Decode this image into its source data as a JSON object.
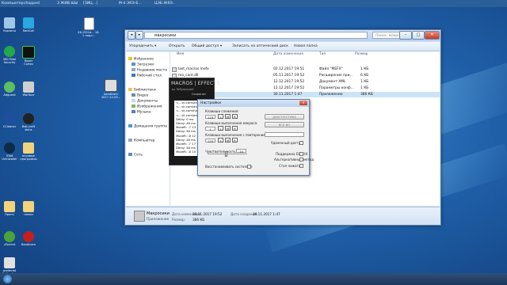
{
  "colors": {
    "desktop": "#1f5fa8",
    "window_frame": "#cfe0f3",
    "macros_bg": "#1a1a1a",
    "close_red": "#c33d26"
  },
  "topstrip": {
    "items": [
      "Компьютер",
      "chopped",
      "3 ЖИВ.ШЫ",
      "[ЗИЦ...]",
      "M-4 ЭКЭ-Б... ",
      "ЦЭБ.ЖЯЭ.."
    ]
  },
  "desktop_icons": [
    {
      "label": "Корзина",
      "icon": "recycle-bin-icon"
    },
    {
      "label": "RaidCall",
      "icon": "raidcall-icon"
    },
    {
      "label": "360 Total Security",
      "icon": "shield-icon"
    },
    {
      "label": "Razer Cortex",
      "icon": "razer-icon"
    },
    {
      "label": "Adguard",
      "icon": "adguard-icon"
    },
    {
      "label": "Warface",
      "icon": "warface-icon"
    },
    {
      "label": "CCleaner",
      "icon": "ccleaner-icon"
    },
    {
      "label": "Ball-craft skins",
      "icon": "ball-icon"
    },
    {
      "label": "IObit Uninstaller",
      "icon": "iobit-icon"
    },
    {
      "label": "игровые программы",
      "icon": "folder-icon"
    },
    {
      "label": "Проги",
      "icon": "folder-icon"
    },
    {
      "label": "папки",
      "icon": "folder-icon"
    },
    {
      "label": "uTorrent",
      "icon": "utorrent-icon"
    },
    {
      "label": "Bandicam",
      "icon": "bandicam-icon"
    },
    {
      "label": "preferred Calibration",
      "icon": "calibration-icon"
    },
    {
      "label": "4K-1551d... 18-1 подл...",
      "icon": "document-icon"
    },
    {
      "label": "bandicam 2017-12-05...",
      "icon": "bandicam-icon"
    }
  ],
  "explorer": {
    "address": "макросики",
    "search_placeholder": "Поиск: макросики",
    "toolbar": [
      "Упорядочить ▾",
      "Открыть",
      "Общий доступ ▾",
      "Записать на оптический диск",
      "Новая папка"
    ],
    "nav": [
      {
        "label": "Избранное",
        "icon": "star-icon"
      },
      {
        "label": "Загрузки",
        "icon": "downloads-icon"
      },
      {
        "label": "Недавние места",
        "icon": "recent-icon"
      },
      {
        "label": "Рабочий стол",
        "icon": "desktop-icon"
      },
      {
        "label": "Библиотеки",
        "icon": "library-icon"
      },
      {
        "label": "Видео",
        "icon": "video-icon"
      },
      {
        "label": "Документы",
        "icon": "documents-icon"
      },
      {
        "label": "Изображения",
        "icon": "images-icon"
      },
      {
        "label": "Музыка",
        "icon": "music-icon"
      },
      {
        "label": "Домашняя группа",
        "icon": "homegroup-icon"
      },
      {
        "label": "Компьютер",
        "icon": "computer-icon"
      },
      {
        "label": "Сеть",
        "icon": "network-icon"
      }
    ],
    "columns": [
      "Имя",
      "Дата изменения",
      "Тип",
      "Размер"
    ],
    "files": [
      {
        "name": "last_macros.mefx",
        "date": "02.12.2017 19:51",
        "type": "Файл \"MEFX\"",
        "size": "1 КБ"
      },
      {
        "name": "ma_core.dll",
        "date": "05.11.2017 19:52",
        "type": "Расширение при...",
        "size": "6 КБ"
      },
      {
        "name": "",
        "date": "12.12.2017 19:52",
        "type": "Документ XML",
        "size": "1 КБ"
      },
      {
        "name": "",
        "date": "12.12.2017 19:52",
        "type": "Параметры конф...",
        "size": "1 КБ"
      },
      {
        "name": "",
        "date": "30.11.2017 1:47",
        "type": "Приложение",
        "size": "386 КБ"
      }
    ],
    "status": {
      "name": "Макросики",
      "changed_label": "Дата изменения:",
      "changed": "30.11.2017 19:52",
      "created_label": "Дата создания:",
      "created": "30.11.2017 1:47",
      "type": "Приложение",
      "size_label": "Размер:",
      "size": "386 КБ"
    }
  },
  "macros_app": {
    "logo": "MACROS | EFFECTS",
    "subtitle": "by TeRyanovski",
    "side_label": "Сохранит",
    "list": [
      "<-- vk.com/ancist",
      "<-- vk.com/ancist",
      "<-- vk.com/funbe",
      "<-- vk.com/ancist",
      "Delay: 0 ms",
      "Delay: 48 ms",
      "MoveR: -7 13",
      "Delay: 48 ms",
      "MoveR: -8 12",
      "Delay: 48 ms",
      "MoveR: -7 17",
      "Delay: 48 ms",
      "MoveR: -6 15"
    ]
  },
  "settings": {
    "title": "Настройки",
    "close": "x",
    "row1_label": "Клавиши слежения:",
    "row1_value": "119",
    "row1_keys": [
      "L",
      "M",
      "R"
    ],
    "row2_label": "Клавиши выполнения макроса:",
    "row2_value": "1",
    "row2_keys": [
      "L",
      "M",
      "R"
    ],
    "row3_label": "Клавиши выполнения с повторением:",
    "row3_value": "120",
    "row3_keys": [
      "L",
      "M",
      "R"
    ],
    "diag_button": "ДИАГНОСТИКА",
    "reset_button": "ВСЕ ВО",
    "remote_label": "Удаленный доступ",
    "sens_label": "Чувствительность:",
    "sens_value": "10",
    "directx_label": "Поддержка DirectX",
    "alt_label": "Альтернативный метод",
    "stop_label": "Стоп нажатий",
    "restore_label": "Восстанавливать состояние"
  }
}
